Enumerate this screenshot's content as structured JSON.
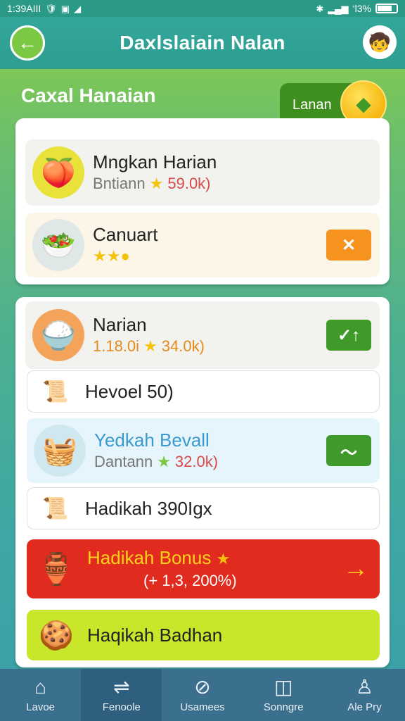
{
  "status": {
    "time": "1:39AIII",
    "signal_text": "’l’ ⋰ 🔋",
    "battery": "‘l3%"
  },
  "header": {
    "title": "Daxlslaiain Nalan"
  },
  "section": {
    "title": "Caxal Hanaian",
    "button_label": "Lanan"
  },
  "card1": {
    "rows": [
      {
        "name": "Mngkan Harian",
        "label": "Bntiann",
        "value": "59.0k)"
      },
      {
        "name": "Canuart",
        "rating": "★★●"
      }
    ]
  },
  "card2": {
    "rows": [
      {
        "name": "Narian",
        "label": "1.18.0i",
        "value": "34.0k)"
      },
      {
        "name": "Hevoel 50)"
      },
      {
        "name": "Yedkah Bevall",
        "label": "Dantann",
        "value": "32.0k)"
      },
      {
        "name": "Hadikah 390Igx"
      },
      {
        "name": "Hadikah Bonus",
        "value": "(+ 1,3, 200%)"
      },
      {
        "name": "Haqikah Badhan"
      }
    ]
  },
  "nav": {
    "items": [
      {
        "label": "Lavoe"
      },
      {
        "label": "Fenoole"
      },
      {
        "label": "Usamees"
      },
      {
        "label": "Sonngre"
      },
      {
        "label": "Ale Pry"
      }
    ]
  },
  "colors": {
    "header": "#2d9e91",
    "accent_green": "#7bc842",
    "action_orange": "#f6931e",
    "action_green": "#3f9a2a",
    "bonus_red": "#e02b1e",
    "lime_row": "#c8e62a",
    "nav_bg": "#3b6f8e"
  }
}
